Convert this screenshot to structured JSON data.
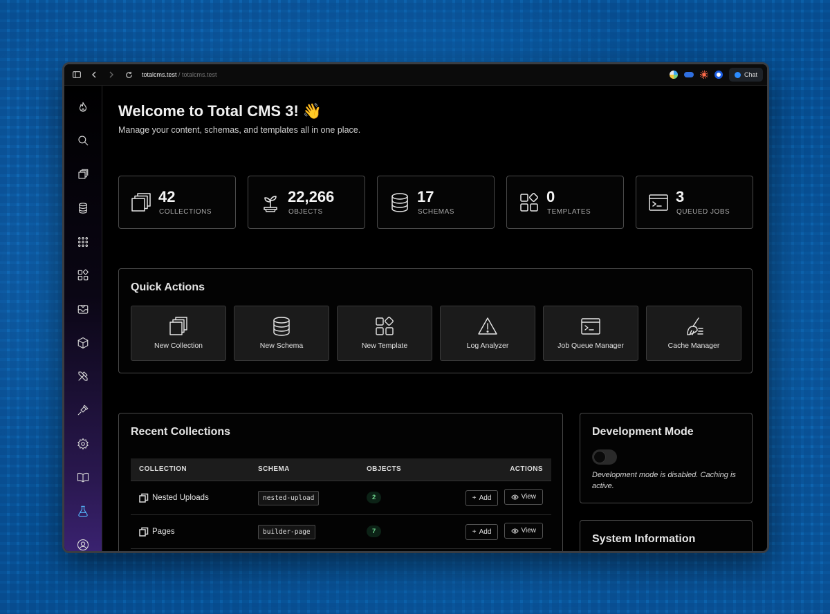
{
  "browser": {
    "url_host": "totalcms.test",
    "url_sep": " / ",
    "url_path": "totalcms.test",
    "chat_label": "Chat"
  },
  "colors": {
    "accent": "#55b9ff",
    "background": "#0b5fa8",
    "count_badge": "#6fd48e"
  },
  "sidebar": {
    "items": [
      {
        "icon": "flame-icon"
      },
      {
        "icon": "search-icon"
      },
      {
        "icon": "collections-icon"
      },
      {
        "icon": "database-icon"
      },
      {
        "icon": "grid-dots-icon"
      },
      {
        "icon": "templates-icon"
      },
      {
        "icon": "inbox-icon"
      },
      {
        "icon": "package-icon"
      },
      {
        "icon": "tools-icon"
      },
      {
        "icon": "plug-icon"
      },
      {
        "icon": "gear-icon"
      },
      {
        "icon": "book-icon"
      },
      {
        "icon": "flask-icon",
        "active": true
      },
      {
        "icon": "user-icon"
      }
    ]
  },
  "header": {
    "title": "Welcome to Total CMS 3! 👋",
    "subtitle": "Manage your content, schemas, and templates all in one place."
  },
  "stats": [
    {
      "value": "42",
      "label": "COLLECTIONS",
      "icon": "collections-icon"
    },
    {
      "value": "22,266",
      "label": "OBJECTS",
      "icon": "plant-icon"
    },
    {
      "value": "17",
      "label": "SCHEMAS",
      "icon": "database-icon"
    },
    {
      "value": "0",
      "label": "TEMPLATES",
      "icon": "templates-icon"
    },
    {
      "value": "3",
      "label": "QUEUED JOBS",
      "icon": "terminal-icon"
    }
  ],
  "quick_actions": {
    "title": "Quick Actions",
    "items": [
      {
        "label": "New Collection",
        "icon": "collections-icon"
      },
      {
        "label": "New Schema",
        "icon": "database-icon"
      },
      {
        "label": "New Template",
        "icon": "templates-icon"
      },
      {
        "label": "Log Analyzer",
        "icon": "warning-icon"
      },
      {
        "label": "Job Queue Manager",
        "icon": "terminal-icon"
      },
      {
        "label": "Cache Manager",
        "icon": "broom-icon"
      }
    ]
  },
  "recent_collections": {
    "title": "Recent Collections",
    "columns": [
      "COLLECTION",
      "SCHEMA",
      "OBJECTS",
      "ACTIONS"
    ],
    "rows": [
      {
        "name": "Nested Uploads",
        "schema": "nested-upload",
        "objects": "2",
        "add": "Add",
        "view": "View"
      },
      {
        "name": "Pages",
        "schema": "builder-page",
        "objects": "7",
        "add": "Add",
        "view": "View"
      }
    ]
  },
  "dev_mode": {
    "title": "Development Mode",
    "enabled": false,
    "note": "Development mode is disabled. Caching is active."
  },
  "system_info": {
    "title": "System Information"
  }
}
